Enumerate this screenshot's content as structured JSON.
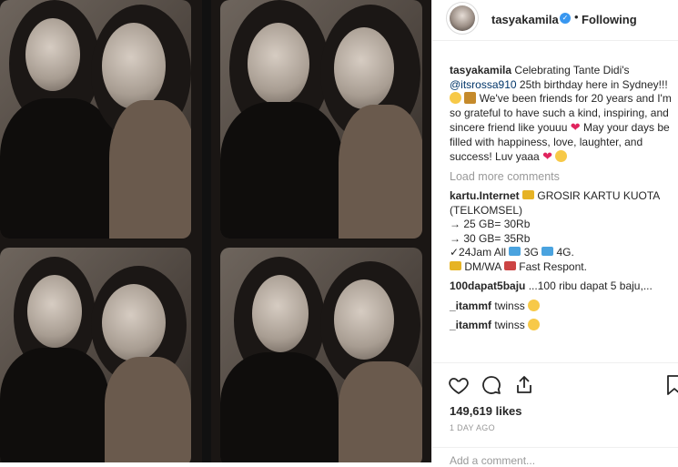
{
  "post": {
    "username": "tasyakamila",
    "follow_status": "Following",
    "separator": "•",
    "caption": {
      "username": "tasyakamila",
      "text_before_mention": "Celebrating Tante Didi's",
      "mention": "@itsrossa910",
      "text_after_mention": "25th birthday here in Sydney!!!",
      "text_2": "We've been friends for 20 years and I'm so grateful to have such a kind, inspiring, and sincere friend like youuu",
      "text_3": "May your days be filled with happiness, love, laughter, and success! Luv yaaa"
    },
    "load_more_label": "Load more comments",
    "comments": [
      {
        "user": "kartu.Internet",
        "line1": "GROSIR KARTU KUOTA (TELKOMSEL)",
        "line2": "→ 25 GB= 30Rb",
        "line3": "→ 30 GB= 35Rb",
        "line4a": "✓24Jam All",
        "line4b": "3G",
        "line4c": "4G.",
        "line5a": "DM/WA",
        "line5b": "Fast Respont."
      },
      {
        "user": "100dapat5baju",
        "text": "...100 ribu dapat 5 baju,..."
      },
      {
        "user": "_itammf",
        "text": "twinss"
      },
      {
        "user": "_itammf",
        "text": "twinss"
      }
    ],
    "likes": "149,619 likes",
    "time_ago": "1 DAY AGO",
    "add_comment_placeholder": "Add a comment..."
  },
  "icons": {
    "like": "heart-outline-icon",
    "comment": "speech-bubble-icon",
    "share": "share-icon",
    "save": "bookmark-icon",
    "verified": "verified-badge-icon"
  },
  "colors": {
    "accent_link": "#003569",
    "verified": "#3897f0",
    "muted": "#999999"
  }
}
